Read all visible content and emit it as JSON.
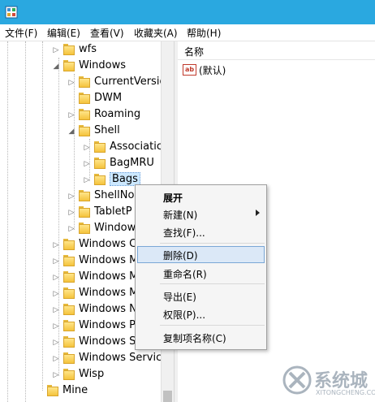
{
  "menubar": {
    "items": [
      "文件(F)",
      "编辑(E)",
      "查看(V)",
      "收藏夹(A)",
      "帮助(H)"
    ]
  },
  "tree": {
    "nodes": [
      {
        "label": "wfs",
        "twisty": "collapsed"
      },
      {
        "label": "Windows",
        "twisty": "expanded"
      },
      {
        "label": "CurrentVersio",
        "twisty": "collapsed"
      },
      {
        "label": "DWM",
        "twisty": "none"
      },
      {
        "label": "Roaming",
        "twisty": "collapsed"
      },
      {
        "label": "Shell",
        "twisty": "expanded"
      },
      {
        "label": "Associatic",
        "twisty": "collapsed"
      },
      {
        "label": "BagMRU",
        "twisty": "collapsed"
      },
      {
        "label": "Bags",
        "twisty": "collapsed",
        "selected": true
      },
      {
        "label": "ShellNo",
        "twisty": "collapsed"
      },
      {
        "label": "TabletP",
        "twisty": "collapsed"
      },
      {
        "label": "Window",
        "twisty": "collapsed"
      },
      {
        "label": "Windows C",
        "twisty": "collapsed"
      },
      {
        "label": "Windows M",
        "twisty": "collapsed"
      },
      {
        "label": "Windows M",
        "twisty": "collapsed"
      },
      {
        "label": "Windows M",
        "twisty": "collapsed"
      },
      {
        "label": "Windows N",
        "twisty": "collapsed"
      },
      {
        "label": "Windows P",
        "twisty": "collapsed"
      },
      {
        "label": "Windows S",
        "twisty": "collapsed"
      },
      {
        "label": "Windows Service",
        "twisty": "collapsed"
      },
      {
        "label": "Wisp",
        "twisty": "collapsed"
      },
      {
        "label": "Mine",
        "twisty": "none"
      }
    ]
  },
  "values_pane": {
    "column_name": "名称",
    "rows": [
      {
        "name": "(默认)",
        "icon": "string-value-icon"
      }
    ]
  },
  "context_menu": {
    "items": [
      {
        "label": "展开",
        "bold": true
      },
      {
        "label": "新建(N)",
        "submenu": true
      },
      {
        "label": "查找(F)..."
      },
      {
        "label": "删除(D)",
        "highlighted": true
      },
      {
        "label": "重命名(R)"
      },
      {
        "label": "导出(E)"
      },
      {
        "label": "权限(P)..."
      },
      {
        "label": "复制项名称(C)"
      }
    ]
  },
  "watermark": {
    "text": "系统城",
    "url": "XITONGCHENG.COM"
  },
  "colors": {
    "titlebar": "#2aa8e0",
    "selection": "#cce8ff",
    "menu_highlight": "#dbe8f7"
  }
}
